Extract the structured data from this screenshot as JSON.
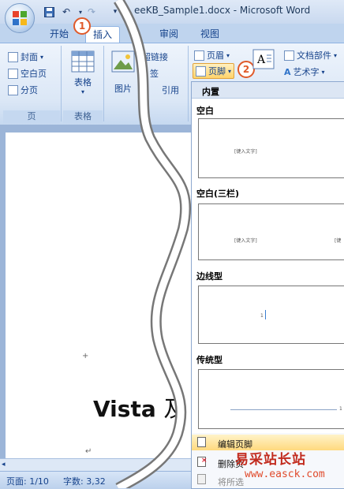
{
  "window": {
    "title": "eeKB_Sample1.docx - Microsoft Word"
  },
  "tabs": [
    {
      "label": "开始"
    },
    {
      "label": "插入"
    },
    {
      "label": "审阅"
    },
    {
      "label": "视图"
    }
  ],
  "badges": {
    "step1": "1",
    "step2": "2"
  },
  "ribbon": {
    "pages": {
      "cover": "封面",
      "blank": "空白页",
      "break": "分页",
      "group": "页"
    },
    "table": {
      "label": "表格",
      "group": "表格"
    },
    "illus": {
      "picture": "图片",
      "hyperlink": "超链接",
      "bookmark": "签",
      "xref": "引用"
    },
    "header_footer": {
      "header": "页眉",
      "footer": "页脚"
    },
    "text": {
      "textbox": "文本框",
      "quickparts": "文档部件",
      "wordart": "艺术字"
    }
  },
  "gallery": {
    "section": "内置",
    "items": [
      {
        "name": "空白",
        "hint": "[键入文字]"
      },
      {
        "name": "空白(三栏)",
        "hint": "[键入文字]",
        "hint2": "[键"
      },
      {
        "name": "边线型",
        "page": "1"
      },
      {
        "name": "传统型",
        "page": "1"
      }
    ]
  },
  "menu": {
    "edit": "编辑页脚",
    "remove": "删除页",
    "save": "将所选"
  },
  "document": {
    "text_bold": "Vista",
    "text_cn": "及"
  },
  "status": {
    "page": "页面: 1/10",
    "words": "字数: 3,32"
  },
  "watermark": {
    "cn": "易采站长站",
    "url": "www.easck.com"
  },
  "colors": {
    "accent": "#15428b",
    "badge": "#e05a2a",
    "highlight": "#ffd36b"
  }
}
